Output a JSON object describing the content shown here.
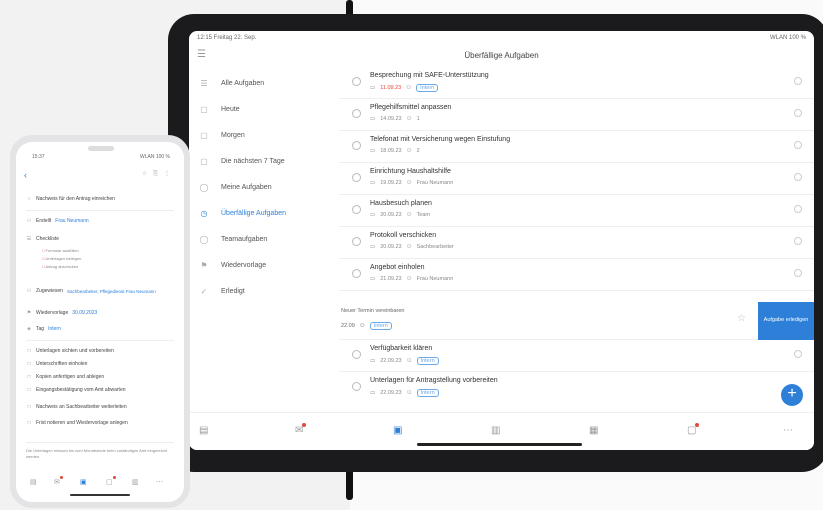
{
  "tablet": {
    "status_time": "12:15 Freitag 22. Sep.",
    "status_right": "WLAN 100 %",
    "title": "Überfällige Aufgaben",
    "sidebar": [
      {
        "label": "Alle Aufgaben",
        "icon": "list-icon",
        "active": false
      },
      {
        "label": "Heute",
        "icon": "calendar-icon",
        "active": false
      },
      {
        "label": "Morgen",
        "icon": "calendar-icon",
        "active": false
      },
      {
        "label": "Die nächsten 7 Tage",
        "icon": "calendar-icon",
        "active": false
      },
      {
        "label": "Meine Aufgaben",
        "icon": "person-icon",
        "active": false
      },
      {
        "label": "Überfällige Aufgaben",
        "icon": "clock-icon",
        "active": true
      },
      {
        "label": "Teamaufgaben",
        "icon": "group-icon",
        "active": false
      },
      {
        "label": "Wiedervorlage",
        "icon": "flag-icon",
        "active": false
      },
      {
        "label": "Erledigt",
        "icon": "check-icon",
        "active": false
      }
    ],
    "tasks": [
      {
        "title": "Besprechung mit SAFE-Unterstützung",
        "date": "11.09.23",
        "extra": "",
        "tag": "Intern"
      },
      {
        "title": "Pflegehilfsmittel anpassen",
        "date": "14.09.23",
        "extra": "1",
        "tag": ""
      },
      {
        "title": "Telefonat mit Versicherung wegen Einstufung",
        "date": "18.09.23",
        "extra": "2",
        "tag": ""
      },
      {
        "title": "Einrichtung Haushaltshilfe",
        "date": "19.09.23",
        "extra": "Frau Neumann",
        "tag": ""
      },
      {
        "title": "Hausbesuch planen",
        "date": "20.09.23",
        "extra": "Team",
        "tag": ""
      },
      {
        "title": "Protokoll verschicken",
        "date": "20.09.23",
        "extra": "Sachbearbeiter",
        "tag": ""
      },
      {
        "title": "Angebot einholen",
        "date": "21.09.23",
        "extra": "Frau Neumann",
        "tag": ""
      }
    ],
    "selected": {
      "title": "Neuer Termin vereinbaren",
      "date": "22.09",
      "tag": "Intern"
    },
    "swipe_action": "Aufgabe erledigen",
    "tasks_after": [
      {
        "title": "Verfügbarkeit klären",
        "date": "22.09.23",
        "extra": "",
        "tag": "Intern"
      },
      {
        "title": "Unterlagen für Antragstellung vorbereiten",
        "date": "22.09.23",
        "extra": "",
        "tag": "Intern"
      }
    ],
    "fab": "+",
    "more": "⋯"
  },
  "phone": {
    "status_time": "15:37",
    "status_right": "WLAN 100 %",
    "back": "‹",
    "task_title": "Nachweis für den Antrag einreichen",
    "assigned_label": "Erstellt",
    "assigned_value": "Frau Neumann",
    "checklist_label": "Checkliste",
    "checklist_items": [
      "Formular ausfüllen",
      "Unterlagen beilegen",
      "Antrag abschicken"
    ],
    "responsible_label": "Zugewiesen",
    "responsible_value": "Sachbearbeiter, Pflegedienst Frau Neumann",
    "due_label": "Wiedervorlage",
    "due_value": "30.09.2023",
    "tag_label": "Tag",
    "tag_value": "Intern",
    "steps": [
      "Unterlagen sichten und vorbereiten",
      "Unterschriften einholen",
      "Kopien anfertigen und ablegen",
      "Eingangsbestätigung vom Amt abwarten",
      "Nachweis an Sachbearbeiter weiterleiten",
      "Frist notieren und Wiedervorlage anlegen"
    ],
    "note": "Die Unterlagen müssen bis zum Monatsende beim zuständigen Amt eingereicht werden."
  }
}
